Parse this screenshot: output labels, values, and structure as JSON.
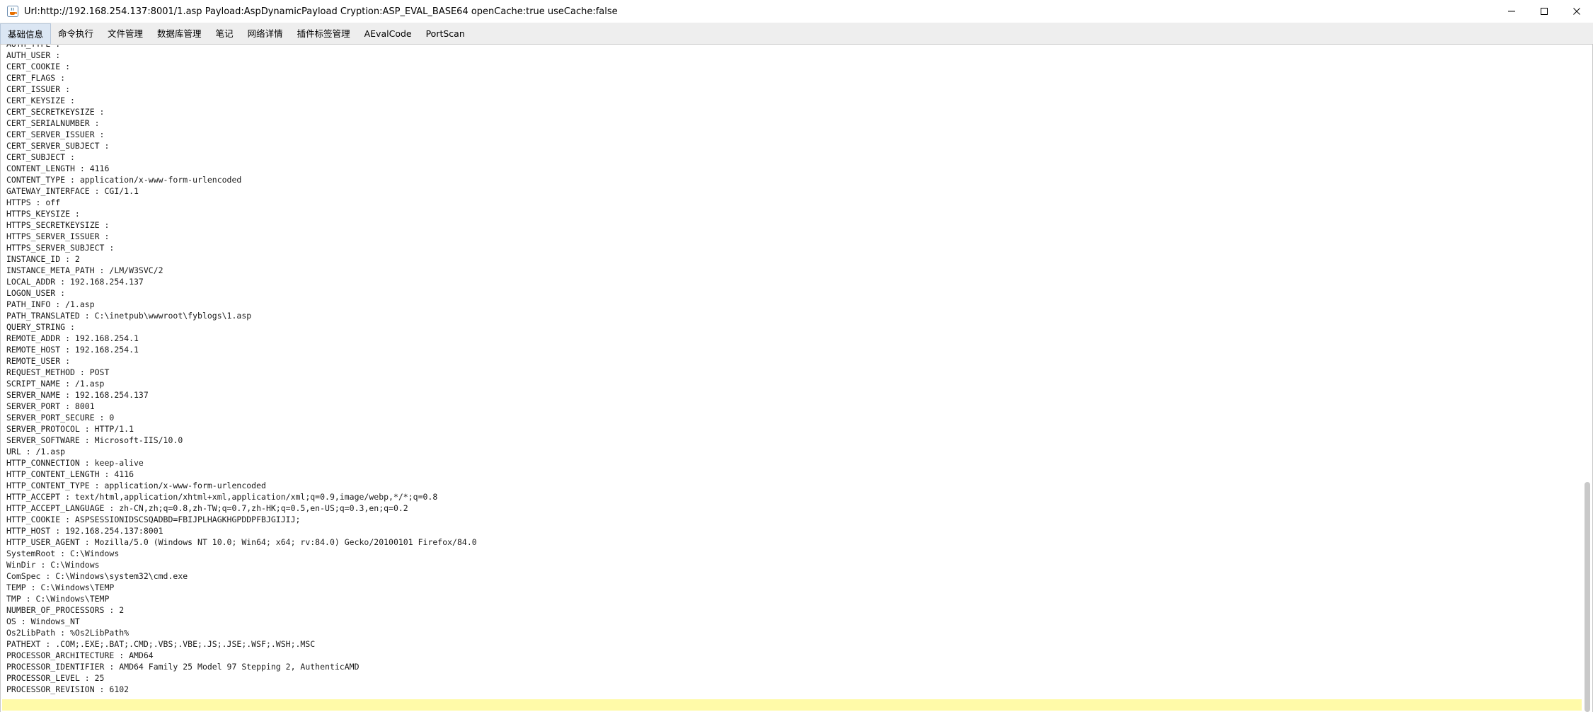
{
  "window": {
    "title": "Url:http://192.168.254.137:8001/1.asp Payload:AspDynamicPayload Cryption:ASP_EVAL_BASE64 openCache:true useCache:false",
    "app_icon": "java-cup-icon",
    "controls": [
      "minimize-icon",
      "maximize-icon",
      "close-icon"
    ]
  },
  "tabs": [
    {
      "label": "基础信息",
      "active": true
    },
    {
      "label": "命令执行",
      "active": false
    },
    {
      "label": "文件管理",
      "active": false
    },
    {
      "label": "数据库管理",
      "active": false
    },
    {
      "label": "笔记",
      "active": false
    },
    {
      "label": "网络详情",
      "active": false
    },
    {
      "label": "插件标签管理",
      "active": false
    },
    {
      "label": "AEvalCode",
      "active": false
    },
    {
      "label": "PortScan",
      "active": false
    }
  ],
  "output": {
    "lines": [
      "AUTH_TYPE :",
      "AUTH_USER :",
      "CERT_COOKIE :",
      "CERT_FLAGS :",
      "CERT_ISSUER :",
      "CERT_KEYSIZE :",
      "CERT_SECRETKEYSIZE :",
      "CERT_SERIALNUMBER :",
      "CERT_SERVER_ISSUER :",
      "CERT_SERVER_SUBJECT :",
      "CERT_SUBJECT :",
      "CONTENT_LENGTH : 4116",
      "CONTENT_TYPE : application/x-www-form-urlencoded",
      "GATEWAY_INTERFACE : CGI/1.1",
      "HTTPS : off",
      "HTTPS_KEYSIZE :",
      "HTTPS_SECRETKEYSIZE :",
      "HTTPS_SERVER_ISSUER :",
      "HTTPS_SERVER_SUBJECT :",
      "INSTANCE_ID : 2",
      "INSTANCE_META_PATH : /LM/W3SVC/2",
      "LOCAL_ADDR : 192.168.254.137",
      "LOGON_USER :",
      "PATH_INFO : /1.asp",
      "PATH_TRANSLATED : C:\\inetpub\\wwwroot\\fyblogs\\1.asp",
      "QUERY_STRING :",
      "REMOTE_ADDR : 192.168.254.1",
      "REMOTE_HOST : 192.168.254.1",
      "REMOTE_USER :",
      "REQUEST_METHOD : POST",
      "SCRIPT_NAME : /1.asp",
      "SERVER_NAME : 192.168.254.137",
      "SERVER_PORT : 8001",
      "SERVER_PORT_SECURE : 0",
      "SERVER_PROTOCOL : HTTP/1.1",
      "SERVER_SOFTWARE : Microsoft-IIS/10.0",
      "URL : /1.asp",
      "HTTP_CONNECTION : keep-alive",
      "HTTP_CONTENT_LENGTH : 4116",
      "HTTP_CONTENT_TYPE : application/x-www-form-urlencoded",
      "HTTP_ACCEPT : text/html,application/xhtml+xml,application/xml;q=0.9,image/webp,*/*;q=0.8",
      "HTTP_ACCEPT_LANGUAGE : zh-CN,zh;q=0.8,zh-TW;q=0.7,zh-HK;q=0.5,en-US;q=0.3,en;q=0.2",
      "HTTP_COOKIE : ASPSESSIONIDSCSQADBD=FBIJPLHAGKHGPDDPFBJGIJIJ;",
      "HTTP_HOST : 192.168.254.137:8001",
      "HTTP_USER_AGENT : Mozilla/5.0 (Windows NT 10.0; Win64; x64; rv:84.0) Gecko/20100101 Firefox/84.0",
      "SystemRoot : C:\\Windows",
      "WinDir : C:\\Windows",
      "ComSpec : C:\\Windows\\system32\\cmd.exe",
      "TEMP : C:\\Windows\\TEMP",
      "TMP : C:\\Windows\\TEMP",
      "NUMBER_OF_PROCESSORS : 2",
      "OS : Windows_NT",
      "Os2LibPath : %Os2LibPath%",
      "PATHEXT : .COM;.EXE;.BAT;.CMD;.VBS;.VBE;.JS;.JSE;.WSF;.WSH;.MSC",
      "PROCESSOR_ARCHITECTURE : AMD64",
      "PROCESSOR_IDENTIFIER : AMD64 Family 25 Model 97 Stepping 2, AuthenticAMD",
      "PROCESSOR_LEVEL : 25",
      "PROCESSOR_REVISION : 6102"
    ]
  },
  "scrollbar": {
    "scroll_fraction": 1.0,
    "visible_fraction": 0.69
  },
  "colors": {
    "current_line_highlight": "#fffaa8",
    "tab_bar_bg": "#eeeeee",
    "active_tab_bg": "#dbe6f3"
  }
}
